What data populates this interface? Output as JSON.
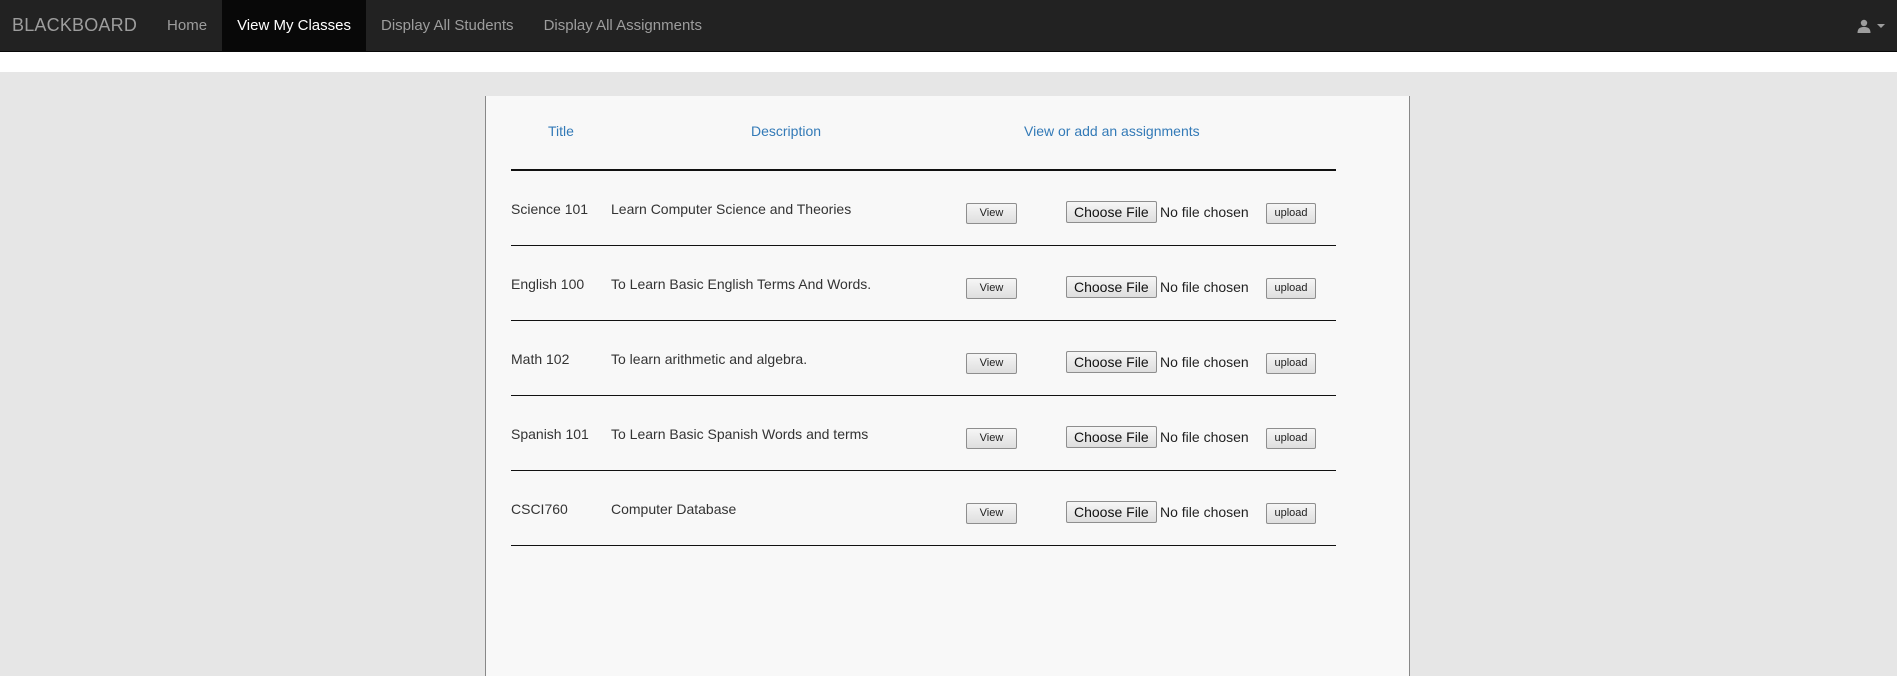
{
  "navbar": {
    "brand": "BLACKBOARD",
    "items": [
      {
        "label": "Home",
        "active": false
      },
      {
        "label": "View My Classes",
        "active": true
      },
      {
        "label": "Display All Students",
        "active": false
      },
      {
        "label": "Display All Assignments",
        "active": false
      }
    ],
    "user_icon": "user-icon"
  },
  "table": {
    "headers": {
      "title": "Title",
      "description": "Description",
      "assignments": "View or add an assignments"
    },
    "rows": [
      {
        "title": "Science 101",
        "description": "Learn Computer Science and Theories",
        "view": "View",
        "choose": "Choose File",
        "file_status": "No file chosen",
        "upload": "upload"
      },
      {
        "title": "English 100",
        "description": "To Learn Basic English Terms And Words.",
        "view": "View",
        "choose": "Choose File",
        "file_status": "No file chosen",
        "upload": "upload"
      },
      {
        "title": "Math 102",
        "description": "To learn arithmetic and algebra.",
        "view": "View",
        "choose": "Choose File",
        "file_status": "No file chosen",
        "upload": "upload"
      },
      {
        "title": "Spanish 101",
        "description": "To Learn Basic Spanish Words and terms",
        "view": "View",
        "choose": "Choose File",
        "file_status": "No file chosen",
        "upload": "upload"
      },
      {
        "title": "CSCI760",
        "description": "Computer Database",
        "view": "View",
        "choose": "Choose File",
        "file_status": "No file chosen",
        "upload": "upload"
      }
    ]
  },
  "colors": {
    "navbar_bg": "#222222",
    "nav_active_bg": "#080808",
    "link_blue": "#337ab7",
    "page_bg": "#e6e6e6",
    "panel_bg": "#f8f8f8"
  }
}
